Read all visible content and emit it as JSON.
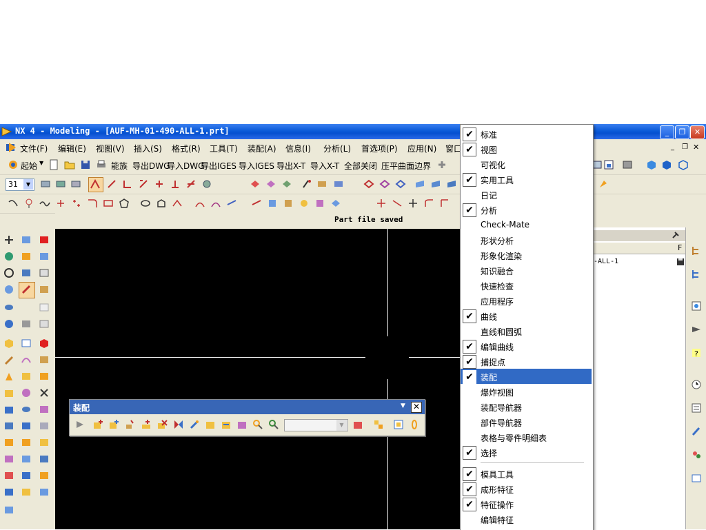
{
  "window": {
    "title": "NX 4 - Modeling - [AUF-MH-01-490-ALL-1.prt]",
    "minimize": "_",
    "restore": "❐",
    "close": "✕"
  },
  "menubar": [
    "文件(F)",
    "编辑(E)",
    "视图(V)",
    "插入(S)",
    "格式(R)",
    "工具(T)",
    "装配(A)",
    "信息(I)",
    "分析(L)",
    "首选项(P)",
    "应用(N)",
    "窗口"
  ],
  "toolbar_text": {
    "start": "起始",
    "items": [
      "能族",
      "导出DWG",
      "导入DWG",
      "导出IGES",
      "导入IGES",
      "导出X-T",
      "导入X-T",
      "全部关闭",
      "压平曲面边界"
    ]
  },
  "layer_value": "31",
  "status": "Part file saved",
  "nav": {
    "item": "-ALL-1",
    "col_header": "F"
  },
  "assembly_toolbar": {
    "title": "装配",
    "close": "✕",
    "combo_value": ""
  },
  "popup_menu": [
    {
      "label": "标准",
      "checked": true
    },
    {
      "label": "视图",
      "checked": true
    },
    {
      "label": "可视化",
      "checked": false
    },
    {
      "label": "实用工具",
      "checked": true
    },
    {
      "label": "日记",
      "checked": false
    },
    {
      "label": "分析",
      "checked": true
    },
    {
      "label": "Check-Mate",
      "checked": false
    },
    {
      "label": "形状分析",
      "checked": false
    },
    {
      "label": "形象化渲染",
      "checked": false
    },
    {
      "label": "知识融合",
      "checked": false
    },
    {
      "label": "快速检查",
      "checked": false
    },
    {
      "label": "应用程序",
      "checked": false
    },
    {
      "label": "曲线",
      "checked": true
    },
    {
      "label": "直线和圆弧",
      "checked": false
    },
    {
      "label": "编辑曲线",
      "checked": true
    },
    {
      "label": "捕捉点",
      "checked": true
    },
    {
      "label": "装配",
      "checked": true,
      "selected": true
    },
    {
      "label": "爆炸视图",
      "checked": false
    },
    {
      "label": "装配导航器",
      "checked": false
    },
    {
      "label": "部件导航器",
      "checked": false
    },
    {
      "label": "表格与零件明细表",
      "checked": false
    },
    {
      "label": "选择",
      "checked": true
    },
    {
      "label": "模具工具",
      "checked": true
    },
    {
      "label": "成形特征",
      "checked": true
    },
    {
      "label": "特征操作",
      "checked": true
    },
    {
      "label": "编辑特征",
      "checked": false
    }
  ],
  "colors": {
    "titlebar": "#0a5ad8",
    "menu_highlight": "#316ac5",
    "canvas": "#000000"
  }
}
